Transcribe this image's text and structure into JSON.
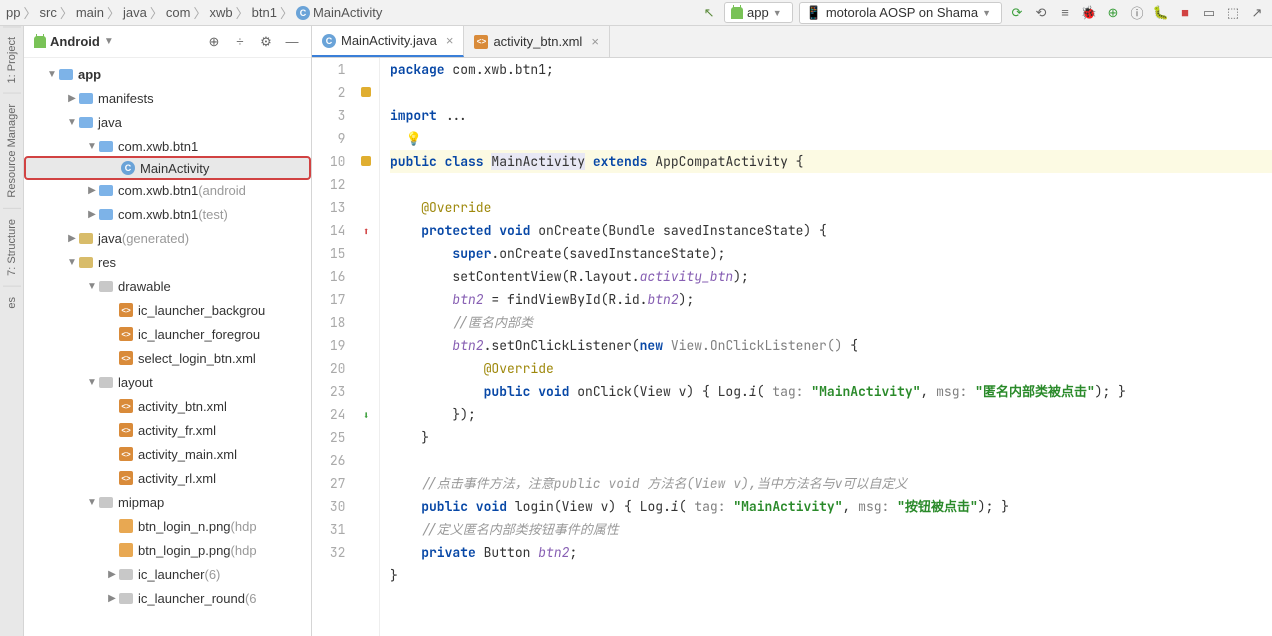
{
  "breadcrumbs": [
    "pp",
    "src",
    "main",
    "java",
    "com",
    "xwb",
    "btn1",
    "MainActivity"
  ],
  "device_combo": "motorola AOSP on Shama",
  "build_combo": "app",
  "panel": {
    "title": "Android"
  },
  "tabs": [
    {
      "label": "MainActivity.java",
      "active": true,
      "type": "class"
    },
    {
      "label": "activity_btn.xml",
      "active": false,
      "type": "xml"
    }
  ],
  "tree": [
    {
      "d": 0,
      "exp": "▼",
      "icon": "folder-blue",
      "label": "app",
      "bold": true
    },
    {
      "d": 1,
      "exp": "▶",
      "icon": "folder-blue",
      "label": "manifests"
    },
    {
      "d": 1,
      "exp": "▼",
      "icon": "folder-blue",
      "label": "java"
    },
    {
      "d": 2,
      "exp": "▼",
      "icon": "folder-blue",
      "label": "com.xwb.btn1"
    },
    {
      "d": 3,
      "exp": "",
      "icon": "class",
      "label": "MainActivity",
      "highlighted": true
    },
    {
      "d": 2,
      "exp": "▶",
      "icon": "folder-blue",
      "label": "com.xwb.btn1",
      "dim": "(android"
    },
    {
      "d": 2,
      "exp": "▶",
      "icon": "folder-blue",
      "label": "com.xwb.btn1",
      "dim": "(test)"
    },
    {
      "d": 1,
      "exp": "▶",
      "icon": "folder-res",
      "label": "java",
      "dim": "(generated)"
    },
    {
      "d": 1,
      "exp": "▼",
      "icon": "folder-res",
      "label": "res"
    },
    {
      "d": 2,
      "exp": "▼",
      "icon": "folder-gray",
      "label": "drawable"
    },
    {
      "d": 3,
      "exp": "",
      "icon": "xml",
      "label": "ic_launcher_backgrou"
    },
    {
      "d": 3,
      "exp": "",
      "icon": "xml",
      "label": "ic_launcher_foregrou"
    },
    {
      "d": 3,
      "exp": "",
      "icon": "xml",
      "label": "select_login_btn.xml"
    },
    {
      "d": 2,
      "exp": "▼",
      "icon": "folder-gray",
      "label": "layout"
    },
    {
      "d": 3,
      "exp": "",
      "icon": "xml",
      "label": "activity_btn.xml"
    },
    {
      "d": 3,
      "exp": "",
      "icon": "xml",
      "label": "activity_fr.xml"
    },
    {
      "d": 3,
      "exp": "",
      "icon": "xml",
      "label": "activity_main.xml"
    },
    {
      "d": 3,
      "exp": "",
      "icon": "xml",
      "label": "activity_rl.xml"
    },
    {
      "d": 2,
      "exp": "▼",
      "icon": "folder-gray",
      "label": "mipmap"
    },
    {
      "d": 3,
      "exp": "",
      "icon": "img",
      "label": "btn_login_n.png",
      "dim": "(hdp"
    },
    {
      "d": 3,
      "exp": "",
      "icon": "img",
      "label": "btn_login_p.png",
      "dim": "(hdp"
    },
    {
      "d": 3,
      "exp": "▶",
      "icon": "folder-gray",
      "label": "ic_launcher",
      "dim": "(6)"
    },
    {
      "d": 3,
      "exp": "▶",
      "icon": "folder-gray",
      "label": "ic_launcher_round",
      "dim": "(6"
    }
  ],
  "line_numbers": [
    1,
    2,
    3,
    9,
    10,
    "",
    12,
    13,
    14,
    15,
    16,
    17,
    18,
    19,
    20,
    23,
    24,
    25,
    26,
    27,
    30,
    31,
    32
  ],
  "gutter_marks": {
    "1": "orange",
    "4": "fold",
    "7": "up",
    "15": "down"
  },
  "code_lines": [
    {
      "html": "<span class='k'>package</span> <span class='t'>com.xwb.btn1;</span>"
    },
    {
      "html": ""
    },
    {
      "html": "<span class='k'>import</span> <span class='t'>...</span>"
    },
    {
      "html": "  <span style='color:#e0ae30'>💡</span>"
    },
    {
      "html": "<span class='k'>public class</span> <span class='hl'>MainActivity</span> <span class='k'>extends</span> <span class='t'>AppCompatActivity {</span>",
      "hl": true
    },
    {
      "html": ""
    },
    {
      "html": "    <span class='a'>@Override</span>"
    },
    {
      "html": "    <span class='k'>protected void</span> <span class='t'>onCreate(Bundle savedInstanceState) {</span>"
    },
    {
      "html": "        <span class='k'>super</span><span class='t'>.onCreate(savedInstanceState);</span>"
    },
    {
      "html": "        <span class='t'>setContentView(R.layout.</span><span class='f'>activity_btn</span><span class='t'>);</span>"
    },
    {
      "html": "        <span class='f'>btn2</span> <span class='t'>= findViewById(R.id.</span><span class='f'>btn2</span><span class='t'>);</span>"
    },
    {
      "html": "        <span class='c'>//匿名内部类</span>"
    },
    {
      "html": "        <span class='f'>btn2</span><span class='t'>.setOnClickListener(</span><span class='k'>new</span> <span class='d'>View.OnClickListener()</span> <span class='t'>{</span>"
    },
    {
      "html": "            <span class='a'>@Override</span>"
    },
    {
      "html": "            <span class='k'>public void</span> <span class='t'>onClick(View v) { Log.</span><span class='i'>i</span><span class='t'>(</span> <span class='d'>tag:</span> <span class='s'>\"MainActivity\"</span><span class='t'>,</span> <span class='d'>msg:</span> <span class='s'>\"匿名内部类被点击\"</span><span class='t'>);</span> <span class='brace'>}</span>"
    },
    {
      "html": "        <span class='t'>});</span>"
    },
    {
      "html": "    <span class='t'>}</span>"
    },
    {
      "html": ""
    },
    {
      "html": "    <span class='c'>//点击事件方法，注意public void 方法名(View v),当中方法名与v可以自定义</span>"
    },
    {
      "html": "    <span class='k'>public void</span> <span class='t'>login(View v)</span> <span class='brace'>{</span> <span class='t'>Log.</span><span class='i'>i</span><span class='t'>(</span> <span class='d'>tag:</span> <span class='s'>\"MainActivity\"</span><span class='t'>,</span> <span class='d'>msg:</span> <span class='s'>\"按钮被点击\"</span><span class='t'>);</span> <span class='brace'>}</span>"
    },
    {
      "html": "    <span class='c'>//定义匿名内部类按钮事件的属性</span>"
    },
    {
      "html": "    <span class='k'>private</span> <span class='t'>Button</span> <span class='f'>btn2</span><span class='t'>;</span>"
    },
    {
      "html": "<span class='t'>}</span>"
    }
  ],
  "vert_tabs": [
    "1: Project",
    "Resource Manager",
    "7: Structure",
    "es"
  ]
}
